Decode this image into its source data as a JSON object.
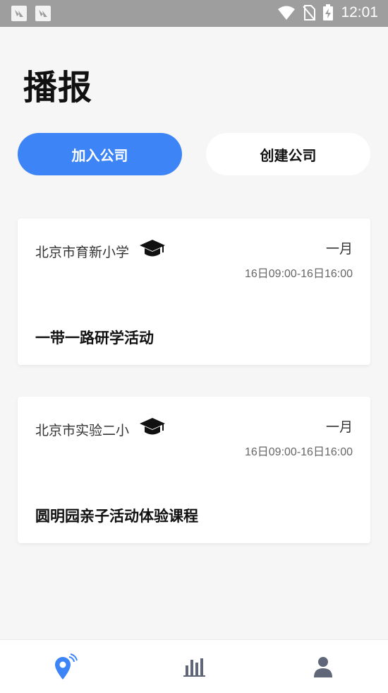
{
  "status_bar": {
    "time": "12:01",
    "icons": [
      "notification-icon",
      "notification-icon",
      "wifi-icon",
      "no-sim-icon",
      "battery-charging-icon"
    ]
  },
  "page": {
    "title": "播报"
  },
  "buttons": {
    "join_label": "加入公司",
    "create_label": "创建公司"
  },
  "cards": [
    {
      "school": "北京市育新小学",
      "month": "一月",
      "time": "16日09:00-16日16:00",
      "title": "一带一路研学活动",
      "icon": "graduation-cap-icon"
    },
    {
      "school": "北京市实验二小",
      "month": "一月",
      "time": "16日09:00-16日16:00",
      "title": "圆明园亲子活动体验课程",
      "icon": "graduation-cap-icon"
    }
  ],
  "tab_bar": {
    "items": [
      {
        "icon": "location-broadcast-icon",
        "active": true
      },
      {
        "icon": "bar-chart-icon",
        "active": false
      },
      {
        "icon": "user-icon",
        "active": false
      }
    ]
  },
  "colors": {
    "accent": "#3d84f7",
    "tab_inactive": "#5f6779"
  }
}
